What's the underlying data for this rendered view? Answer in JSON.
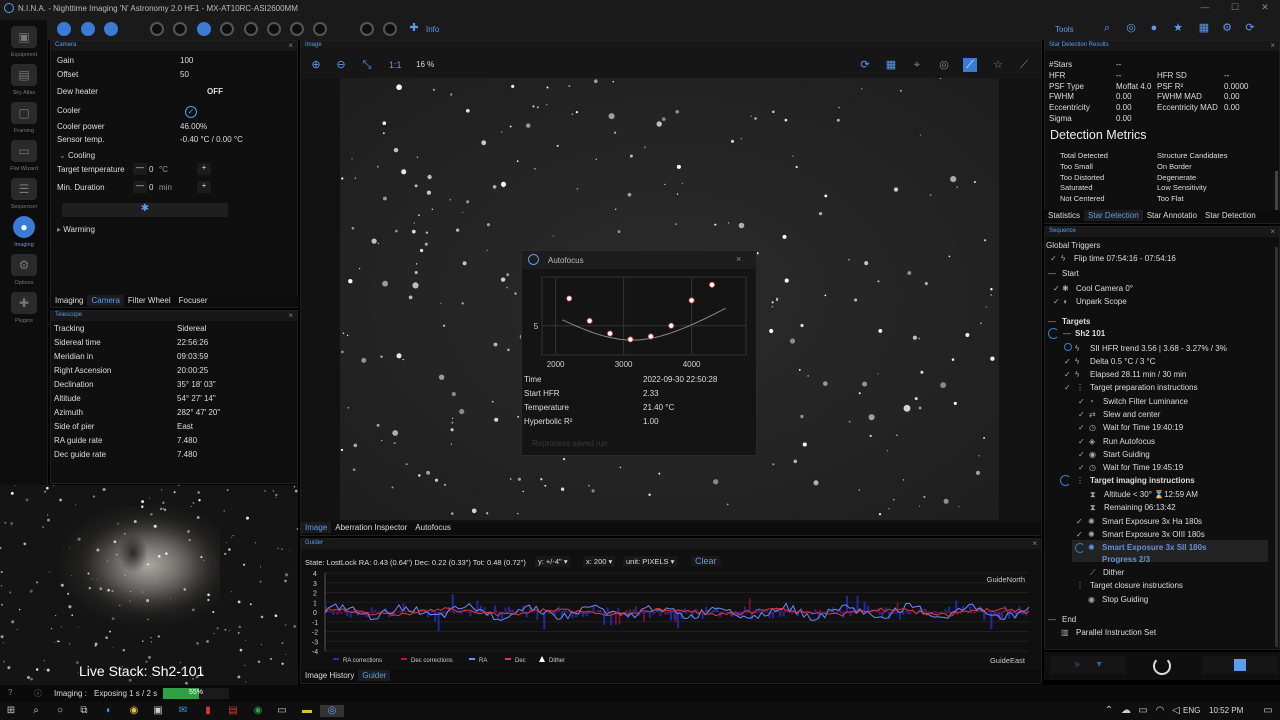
{
  "window": {
    "title": "N.I.N.A. - Nighttime Imaging 'N' Astronomy 2.0 HF1  -  MX-AT10RC-ASI2600MM",
    "minimize": "—",
    "maximize": "☐",
    "close": "✕"
  },
  "toolbar": {
    "info_label": "Info",
    "tools_label": "Tools"
  },
  "sidebar": {
    "items": [
      {
        "label": "Equipment"
      },
      {
        "label": "Sky Atlas"
      },
      {
        "label": "Framing"
      },
      {
        "label": "Flat Wizard"
      },
      {
        "label": "Sequencer"
      },
      {
        "label": "Imaging"
      },
      {
        "label": "Options"
      },
      {
        "label": "Plugins"
      }
    ]
  },
  "camera": {
    "header": "Camera",
    "rows": [
      {
        "label": "Gain",
        "value": "100"
      },
      {
        "label": "Offset",
        "value": "50"
      },
      {
        "label": "Dew heater",
        "value": "OFF"
      },
      {
        "label": "Cooler",
        "value": ""
      },
      {
        "label": "Cooler power",
        "value": "46.00%"
      },
      {
        "label": "Sensor temp.",
        "value": "-0.40 °C / 0.00 °C"
      }
    ],
    "cooling_label": "Cooling",
    "target_temp_label": "Target temperature",
    "target_temp_value": "0",
    "target_temp_unit": "°C",
    "min_duration_label": "Min. Duration",
    "min_duration_value": "0",
    "min_duration_unit": "min",
    "warming_label": "Warming",
    "tabs": [
      "Imaging",
      "Camera",
      "Filter Wheel",
      "Focuser"
    ]
  },
  "telescope": {
    "header": "Telescope",
    "rows": [
      {
        "label": "Tracking",
        "value": "Sidereal"
      },
      {
        "label": "Sidereal time",
        "value": "22:56:26"
      },
      {
        "label": "Meridian in",
        "value": "09:03:59"
      },
      {
        "label": "Right Ascension",
        "value": "20:00:25"
      },
      {
        "label": "Declination",
        "value": "35° 18' 03\""
      },
      {
        "label": "Altitude",
        "value": "54° 27' 14\""
      },
      {
        "label": "Azimuth",
        "value": "282° 47' 20\""
      },
      {
        "label": "Side of pier",
        "value": "East"
      },
      {
        "label": "RA guide rate",
        "value": "7.480"
      },
      {
        "label": "Dec guide rate",
        "value": "7.480"
      }
    ]
  },
  "overlay": {
    "caption": "Live Stack: Sh2-101"
  },
  "image": {
    "header": "Image",
    "zoom_ratio": "1:1",
    "zoom_percent": "16 %",
    "tabs": [
      "Image",
      "Aberration Inspector",
      "Autofocus"
    ]
  },
  "autofocus": {
    "title": "Autofocus",
    "x_ticks": [
      "2000",
      "3000",
      "4000"
    ],
    "y_tick": "5",
    "rows": [
      {
        "label": "Time",
        "value": "2022-09-30 22:50:28"
      },
      {
        "label": "Start HFR",
        "value": "2.33"
      },
      {
        "label": "Temperature",
        "value": "21.40 °C"
      },
      {
        "label": "Hyperbolic R²",
        "value": "1.00"
      }
    ],
    "faded_button": "Reprocess saved run"
  },
  "chart_data": [
    {
      "type": "scatter",
      "title": "Autofocus",
      "x": [
        2200,
        2500,
        2800,
        3100,
        3400,
        3700,
        4000,
        4300
      ],
      "y": [
        7.8,
        5.5,
        4.2,
        3.6,
        3.9,
        5.0,
        7.6,
        9.2
      ],
      "xlim": [
        1800,
        4800
      ],
      "x_ticks": [
        2000,
        3000,
        4000
      ],
      "y_ticks": [
        5
      ]
    },
    {
      "type": "line",
      "title": "Guider",
      "series": [
        {
          "name": "RA"
        },
        {
          "name": "Dec"
        }
      ],
      "ylim": [
        -4,
        4
      ],
      "y_ticks": [
        4,
        3,
        2,
        1,
        0,
        -1,
        -2,
        -3,
        -4
      ],
      "legend": [
        "RA corrections",
        "Dec corrections",
        "RA",
        "Dec",
        "Dither"
      ]
    }
  ],
  "guider": {
    "header": "Guider",
    "state": "State: LostLock  RA: 0.43 (0.64\")  Dec: 0.22 (0.33\")  Tot: 0.48 (0.72\")",
    "y_select": "y: +/-4\"",
    "x_select": "x: 200",
    "unit_select": "unit: PIXELS",
    "clear_label": "Clear",
    "north_label": "GuideNorth",
    "east_label": "GuideEast",
    "y_ticks": [
      "4",
      "3",
      "2",
      "1",
      "0",
      "-1",
      "-2",
      "-3",
      "-4"
    ],
    "legend": [
      "RA corrections",
      "Dec corrections",
      "RA",
      "Dec",
      "Dither"
    ],
    "tabs": [
      "Image History",
      "Guider"
    ]
  },
  "stardet": {
    "header": "Star Detection Results",
    "left": [
      {
        "label": "#Stars",
        "value": "--"
      },
      {
        "label": "HFR",
        "value": "--"
      },
      {
        "label": "PSF Type",
        "value": "Moffat 4.0"
      },
      {
        "label": "FWHM",
        "value": "0.00"
      },
      {
        "label": "Eccentricity",
        "value": "0.00"
      },
      {
        "label": "Sigma",
        "value": "0.00"
      }
    ],
    "right": [
      {
        "label": "",
        "value": ""
      },
      {
        "label": "HFR SD",
        "value": "--"
      },
      {
        "label": "PSF R²",
        "value": "0.0000"
      },
      {
        "label": "FWHM MAD",
        "value": "0.00"
      },
      {
        "label": "Eccentricity MAD",
        "value": "0.00"
      },
      {
        "label": "",
        "value": ""
      }
    ],
    "metrics_title": "Detection Metrics",
    "metrics_left": [
      "Total Detected",
      "Too Small",
      "Too Distorted",
      "Saturated",
      "Not Centered"
    ],
    "metrics_right": [
      "Structure Candidates",
      "On Border",
      "Degenerate",
      "Low Sensitivity",
      "Too Flat"
    ],
    "tabs": [
      "Statistics",
      "Star Detection",
      "Star Annotatio",
      "Star Detection"
    ]
  },
  "sequence": {
    "header": "Sequence",
    "global_triggers": "Global Triggers",
    "flip_time": "Flip time 07:54:16 - 07:54:16",
    "start": "Start",
    "cool_camera": "Cool Camera 0°",
    "unpark": "Unpark Scope",
    "targets": "Targets",
    "target_name": "Sh2 101",
    "sii_trend": "SII HFR trend 3.56 | 3.68 - 3.27% / 3%",
    "delta": "Delta 0.5 °C / 3 °C",
    "elapsed": "Elapsed 28.11 min / 30 min",
    "prep": "Target preparation instructions",
    "switch_filter": "Switch Filter Luminance",
    "slew": "Slew and center",
    "wait1": "Wait for Time 19:40:19",
    "run_af": "Run Autofocus",
    "start_guiding": "Start Guiding",
    "wait2": "Wait for Time 19:45:19",
    "imaging_instr": "Target imaging instructions",
    "altitude": "Altitude < 30° ⌛12:59 AM",
    "remaining": "Remaining 06:13:42",
    "exp_ha": "Smart Exposure 3x Ha 180s",
    "exp_oiii": "Smart Exposure 3x OIII 180s",
    "exp_sii": "Smart Exposure 3x SII 180s",
    "progress": "Progress 2/3",
    "dither": "Dither",
    "closure": "Target closure instructions",
    "stop_guiding": "Stop Guiding",
    "end": "End",
    "parallel": "Parallel Instruction Set"
  },
  "status": {
    "label": "Imaging :",
    "text": "Exposing 1 s / 2 s",
    "progress": 0.55,
    "progress_text": "55%"
  },
  "taskbar": {
    "lang": "ENG",
    "time": "10:52 PM"
  },
  "colors": {
    "accent": "#3a7bd5",
    "progress": "#2ea043",
    "ra": "#3d5aff",
    "dec": "#e03a3a"
  }
}
